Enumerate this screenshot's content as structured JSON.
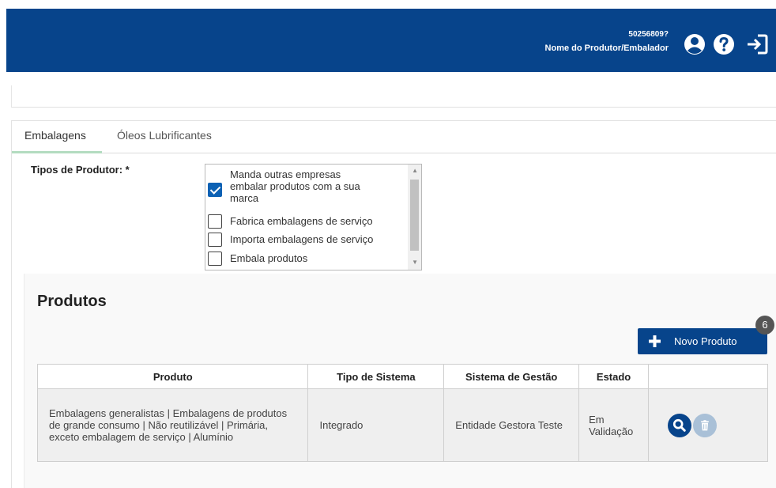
{
  "header": {
    "user_id": "50256809?",
    "user_name": "Nome do Produtor/Embalador",
    "icons": [
      "user-circle-icon",
      "help-circle-icon",
      "logout-icon"
    ],
    "colors": {
      "brand": "#07448b",
      "text": "#ffffff"
    }
  },
  "tabs": [
    {
      "label": "Embalagens",
      "active": true
    },
    {
      "label": "Óleos Lubrificantes",
      "active": false
    }
  ],
  "tipos": {
    "label": "Tipos de Produtor: *",
    "options": [
      {
        "label": "Manda outras empresas embalar produtos com a sua marca",
        "lines": [
          "Manda outras empresas",
          "embalar produtos com a sua",
          "marca"
        ],
        "checked": true
      },
      {
        "label": "Fabrica embalagens de serviço",
        "checked": false
      },
      {
        "label": "Importa embalagens de serviço",
        "checked": false
      },
      {
        "label": "Embala produtos",
        "checked": false
      }
    ]
  },
  "produtos": {
    "title": "Produtos",
    "new_button_label": "Novo Produto",
    "badge_count": "6",
    "columns": [
      "Produto",
      "Tipo de Sistema",
      "Sistema de Gestão",
      "Estado",
      ""
    ],
    "rows": [
      {
        "produto": "Embalagens generalistas | Embalagens de produtos de grande consumo | Não reutilizável | Primária, exceto embalagem de serviço | Alumínio",
        "tipo_sistema": "Integrado",
        "sistema_gestao": "Entidade Gestora Teste",
        "estado": "Em Validação"
      }
    ],
    "colors": {
      "accent": "#07448b",
      "delete": "#a9c0d7",
      "badge": "#555555"
    }
  }
}
